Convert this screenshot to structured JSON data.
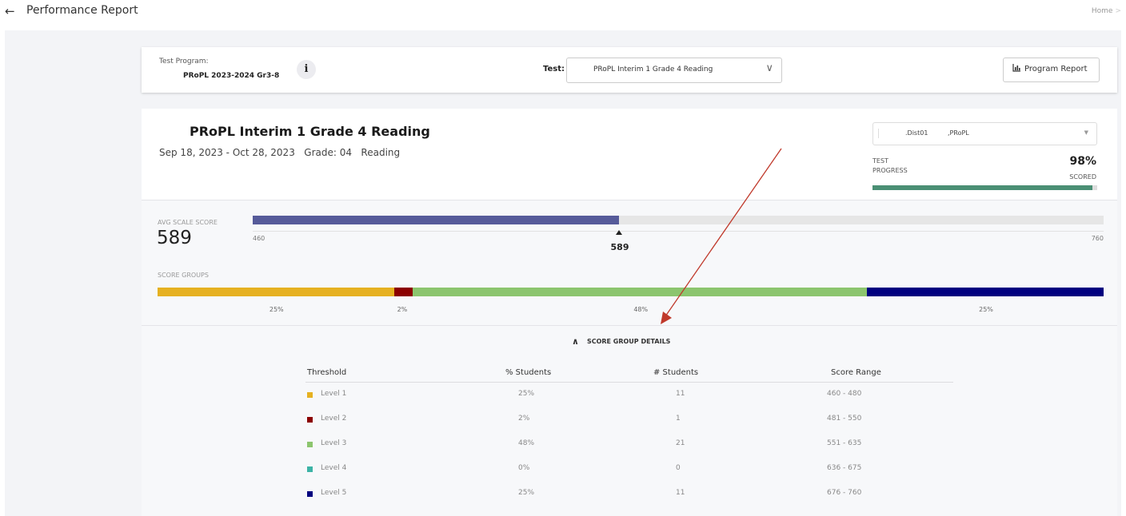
{
  "header": {
    "back_icon": "arrow-left-icon",
    "title": "Performance Report",
    "breadcrumb": "Home",
    "breadcrumb_sep": ">"
  },
  "filters": {
    "test_program_label": "Test Program:",
    "test_program_value": "PRoPL 2023-2024 Gr3-8",
    "info_icon": "i",
    "test_label": "Test:",
    "test_value": "PRoPL Interim 1 Grade 4 Reading",
    "test_chevron": "chevron-down-icon",
    "program_report_label": "Program Report",
    "program_report_icon": "bar-chart-icon"
  },
  "report": {
    "title": "PRoPL Interim 1 Grade 4 Reading",
    "meta": "Sep 18, 2023 - Oct 28, 2023   Grade: 04   Reading",
    "org_select": {
      "value1": ".Dist01",
      "value2": ",PRoPL"
    },
    "test_progress": {
      "label": "TEST\nPROGRESS",
      "percent_text": "98%",
      "status": "SCORED",
      "fraction": 0.98,
      "color": "#4a8f74"
    }
  },
  "avg_scale": {
    "label": "AVG SCALE SCORE",
    "value": "589",
    "min": 460,
    "max": 760,
    "score": 589,
    "min_label": "460",
    "max_label": "760",
    "marker_label": "589",
    "color": "#565b9a"
  },
  "score_groups": {
    "label": "SCORE GROUPS",
    "segments": [
      {
        "name": "Level 1",
        "percent": 25,
        "label": "25%",
        "color": "#e6b121"
      },
      {
        "name": "Level 2",
        "percent": 2,
        "label": "2%",
        "color": "#8b0000"
      },
      {
        "name": "Level 3",
        "percent": 48,
        "label": "48%",
        "color": "#8cc56e"
      },
      {
        "name": "Level 4",
        "percent": 0,
        "label": "",
        "color": "#3cb3a6"
      },
      {
        "name": "Level 5",
        "percent": 25,
        "label": "25%",
        "color": "#00007f"
      }
    ]
  },
  "details": {
    "toggle_label": "SCORE GROUP DETAILS",
    "columns": [
      "Threshold",
      "% Students",
      "# Students",
      "Score Range"
    ],
    "rows": [
      {
        "level": "Level 1",
        "pct": "25%",
        "count": "11",
        "range": "460 - 480",
        "color": "#e6b121"
      },
      {
        "level": "Level 2",
        "pct": "2%",
        "count": "1",
        "range": "481 - 550",
        "color": "#8b0000"
      },
      {
        "level": "Level 3",
        "pct": "48%",
        "count": "21",
        "range": "551 - 635",
        "color": "#8cc56e"
      },
      {
        "level": "Level 4",
        "pct": "0%",
        "count": "0",
        "range": "636 - 675",
        "color": "#3cb3a6"
      },
      {
        "level": "Level 5",
        "pct": "25%",
        "count": "11",
        "range": "676 - 760",
        "color": "#00007f"
      }
    ]
  }
}
